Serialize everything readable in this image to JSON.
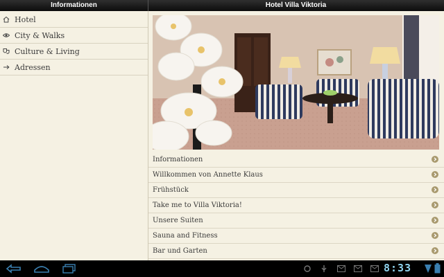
{
  "header": {
    "left_title": "Informationen",
    "right_title": "Hotel Villa Viktoria"
  },
  "sidebar": {
    "items": [
      {
        "label": "Hotel",
        "icon": "home-icon"
      },
      {
        "label": "City & Walks",
        "icon": "eye-icon"
      },
      {
        "label": "Culture & Living",
        "icon": "masks-icon"
      },
      {
        "label": "Adressen",
        "icon": "arrow-right-icon"
      }
    ]
  },
  "main": {
    "photo": "hotel-suite-photo",
    "list": [
      "Informationen",
      "Willkommen von Annette Klaus",
      "Frühstück",
      "Take me to Villa Viktoria!",
      "Unsere Suiten",
      "Sauna and Fitness",
      "Bar und Garten"
    ]
  },
  "statusbar": {
    "time": "8:33",
    "colors": {
      "clock": "#8fd3ee",
      "nav": "#3a7fb0"
    }
  },
  "colors": {
    "background": "#f5f1e3",
    "chevron": "#a99a6f",
    "topbar": "#111111"
  }
}
